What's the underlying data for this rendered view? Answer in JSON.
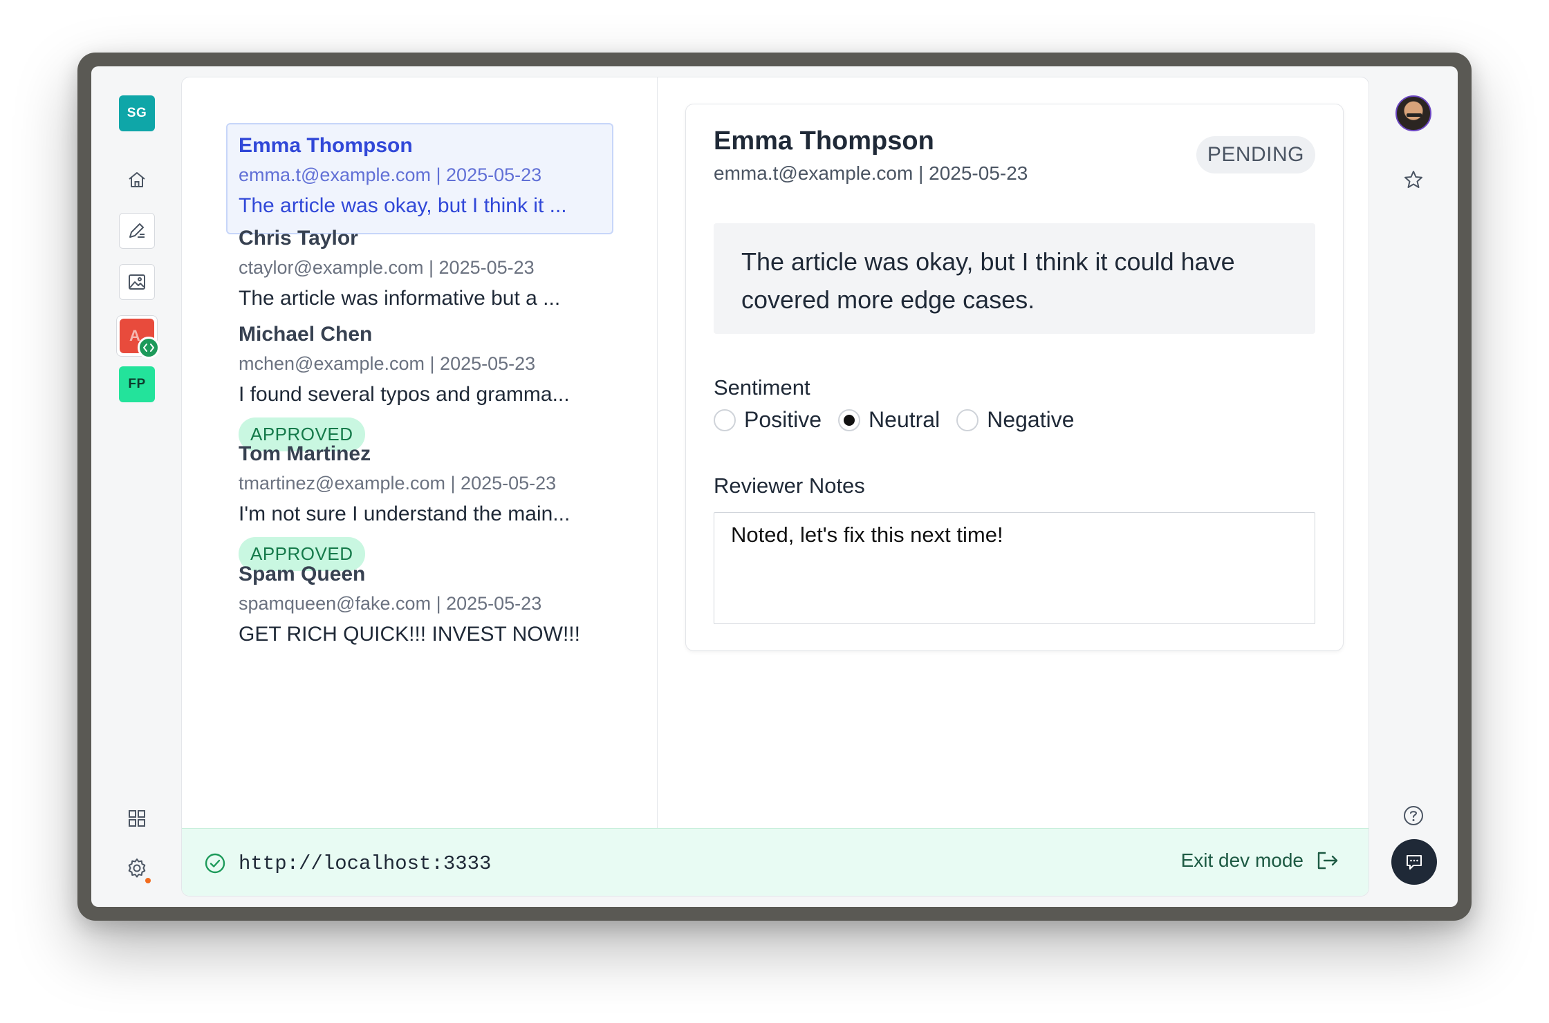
{
  "rail": {
    "top_tile": "SG",
    "app_tile": "A",
    "fp_tile": "FP"
  },
  "feedback": [
    {
      "name": "Emma Thompson",
      "email": "emma.t@example.com",
      "date": "2025-05-23",
      "snippet": "The article was okay, but I think it ...",
      "status": ""
    },
    {
      "name": "Chris Taylor",
      "email": "ctaylor@example.com",
      "date": "2025-05-23",
      "snippet": "The article was informative but a ...",
      "status": ""
    },
    {
      "name": "Michael Chen",
      "email": "mchen@example.com",
      "date": "2025-05-23",
      "snippet": "I found several typos and gramma...",
      "status": "APPROVED"
    },
    {
      "name": "Tom Martinez",
      "email": "tmartinez@example.com",
      "date": "2025-05-23",
      "snippet": "I'm not sure I understand the main...",
      "status": "APPROVED"
    },
    {
      "name": "Spam Queen",
      "email": "spamqueen@fake.com",
      "date": "2025-05-23",
      "snippet": "GET RICH QUICK!!! INVEST NOW!!!",
      "status": ""
    }
  ],
  "meta_separator": " | ",
  "detail": {
    "name": "Emma Thompson",
    "email": "emma.t@example.com",
    "date": "2025-05-23",
    "status": "PENDING",
    "comment": "The article was okay, but I think it could have covered more edge cases.",
    "sentiment_label": "Sentiment",
    "sentiment_options": [
      "Positive",
      "Neutral",
      "Negative"
    ],
    "sentiment_selected": "Neutral",
    "notes_label": "Reviewer Notes",
    "notes_value": "Noted, let's fix this next time!"
  },
  "devbar": {
    "url": "http://localhost:3333",
    "exit_label": "Exit dev mode"
  },
  "colors": {
    "accent_blue": "#3148d8",
    "approved_bg": "#c9f7e1",
    "approved_text": "#157a4a",
    "devbar_bg": "#e8fbf3"
  }
}
